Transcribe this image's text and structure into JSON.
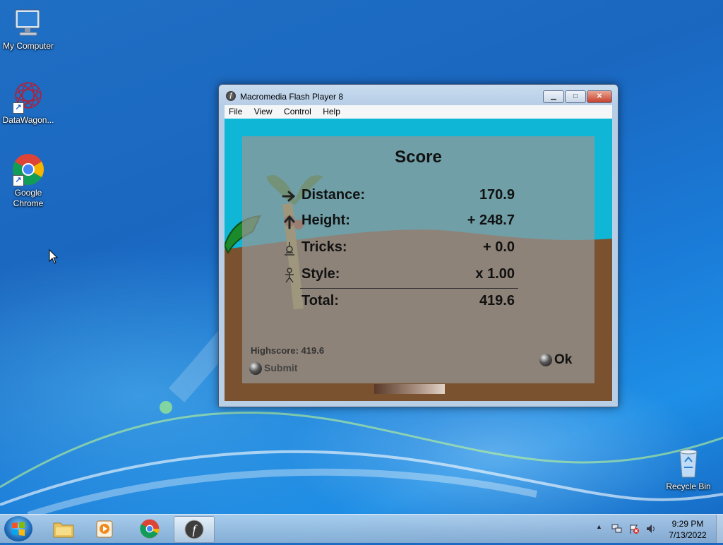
{
  "desktop": {
    "icons": [
      {
        "label": "My Computer",
        "icon": "computer-icon"
      },
      {
        "label": "DataWagon...",
        "icon": "datawagon-icon"
      },
      {
        "label": "Google Chrome",
        "icon": "chrome-icon"
      },
      {
        "label": "Recycle Bin",
        "icon": "recycle-bin-icon"
      }
    ]
  },
  "window": {
    "title": "Macromedia Flash Player 8",
    "controls": {
      "minimize": "▁",
      "maximize": "□",
      "close": "✕"
    },
    "menu": [
      "File",
      "View",
      "Control",
      "Help"
    ]
  },
  "game": {
    "score_title": "Score",
    "rows": [
      {
        "label": "Distance:",
        "value": "170.9",
        "icon": "arrow-right-icon"
      },
      {
        "label": "Height:",
        "value": "+ 248.7",
        "icon": "arrow-up-icon"
      },
      {
        "label": "Tricks:",
        "value": "+ 0.0",
        "icon": "trick-figure-icon"
      },
      {
        "label": "Style:",
        "value": "x 1.00",
        "icon": "stick-figure-icon"
      },
      {
        "label": "Total:",
        "value": "419.6",
        "icon": ""
      }
    ],
    "highscore": "Highscore: 419.6",
    "submit_label": "Submit",
    "ok_label": "Ok"
  },
  "taskbar": {
    "items": [
      "start-orb",
      "file-explorer-icon",
      "media-player-icon",
      "chrome-icon",
      "flash-player-icon"
    ],
    "clock_time": "9:29 PM",
    "clock_date": "7/13/2022",
    "tray_up": "▲"
  },
  "colors": {
    "desktop_blue": "#1a67c0",
    "sky": "#0fb6d6",
    "ground": "#7b5230",
    "palm_green": "#1a8a2b"
  }
}
